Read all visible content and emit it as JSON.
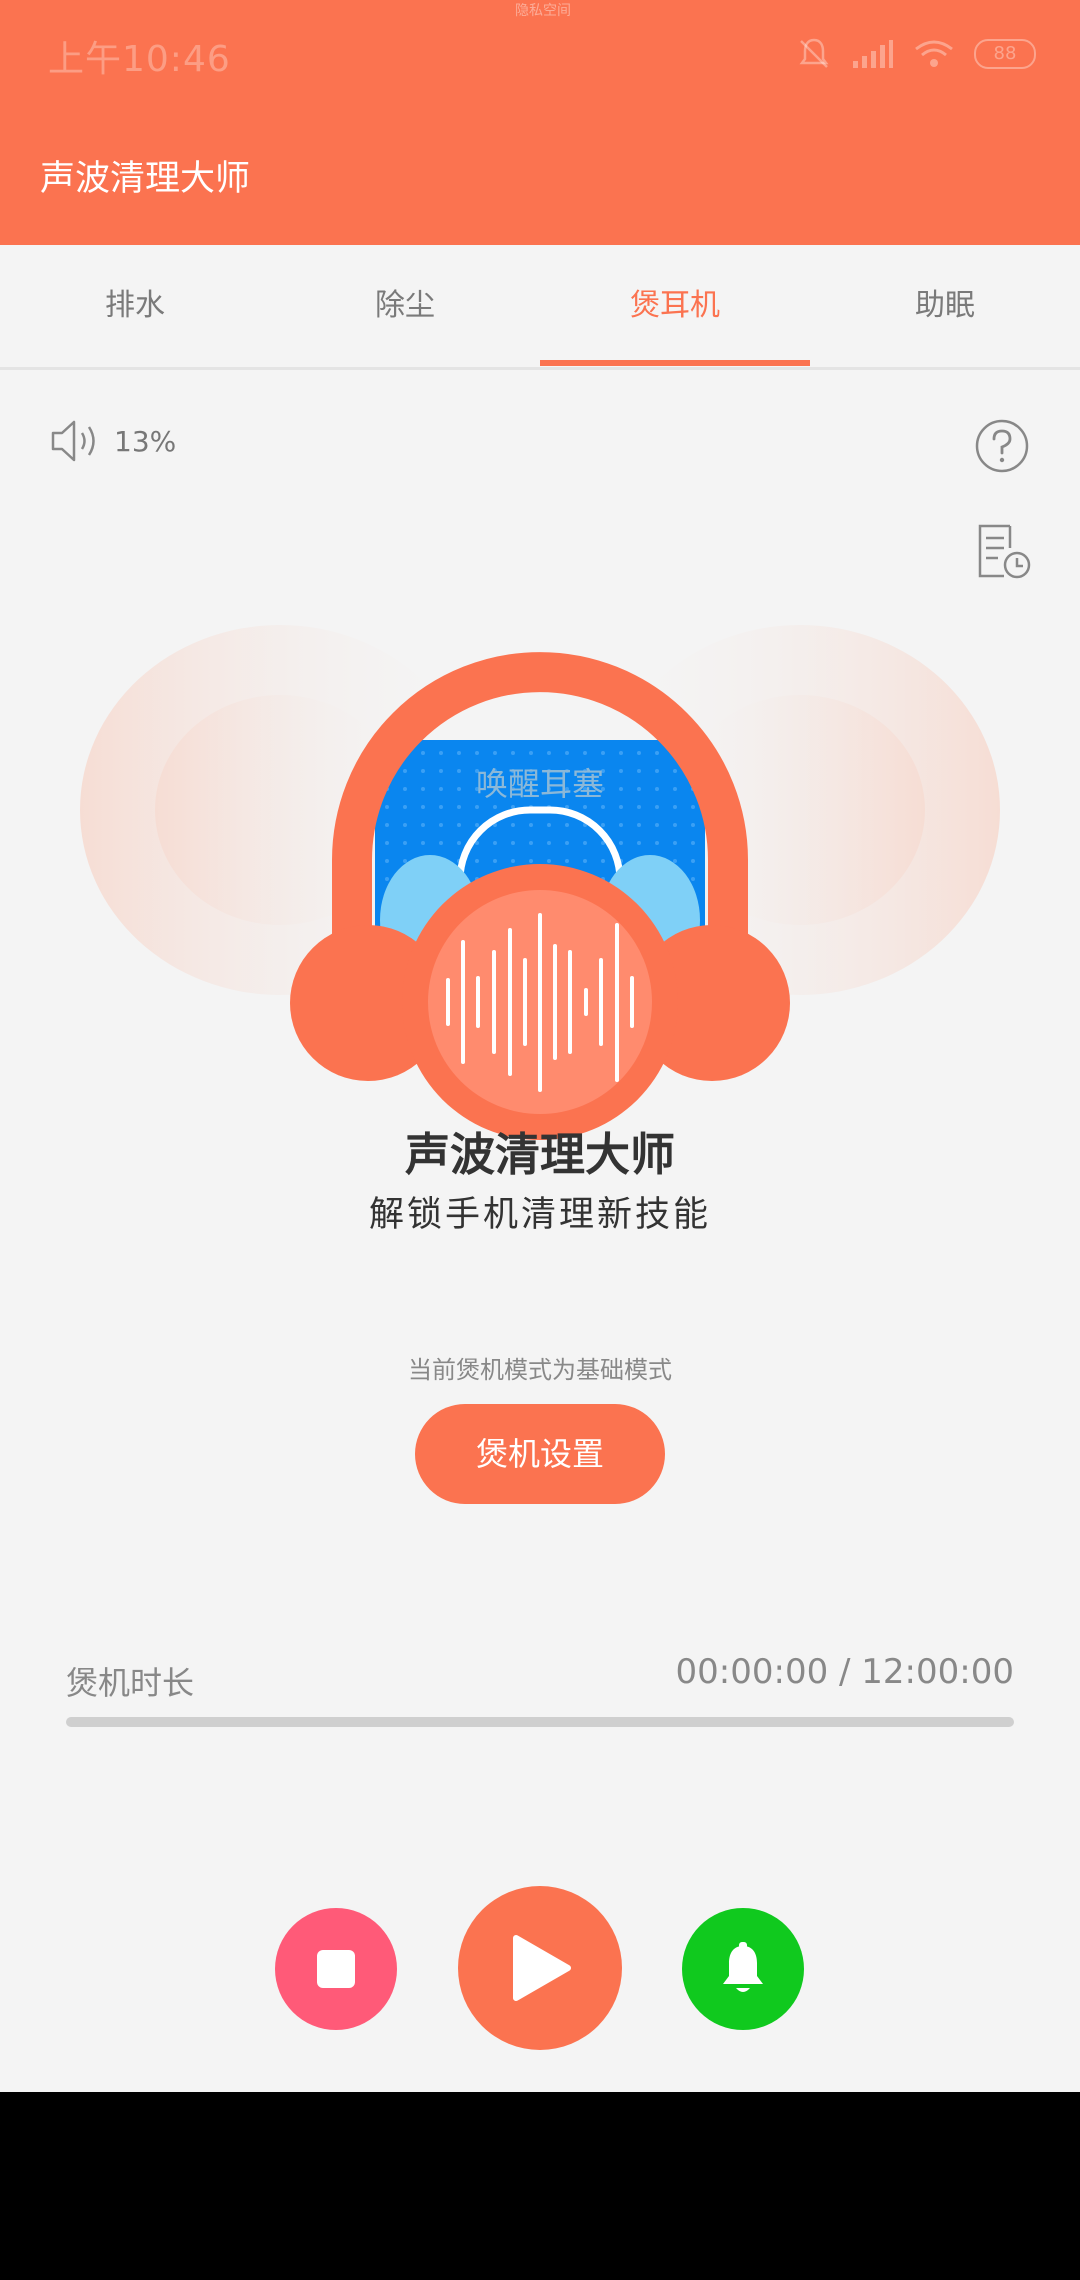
{
  "status_bar": {
    "time": "上午10:46",
    "battery": "88",
    "notch_label": "隐私空间"
  },
  "header": {
    "title": "声波清理大师"
  },
  "tabs": [
    {
      "label": "排水"
    },
    {
      "label": "除尘"
    },
    {
      "label": "煲耳机",
      "active": true
    },
    {
      "label": "助眠"
    }
  ],
  "volume": {
    "value_text": "13%"
  },
  "hero": {
    "overlay_text": "唤醒耳塞",
    "title": "声波清理大师",
    "subtitle": "解锁手机清理新技能"
  },
  "mode": {
    "text": "当前煲机模式为基础模式",
    "button_label": "煲机设置"
  },
  "duration": {
    "label": "煲机时长",
    "time": "00:00:00 / 12:00:00",
    "progress": 0
  },
  "controls": {
    "stop_color": "#ff5a78",
    "play_color": "#fb7350",
    "bell_color": "#10c91e"
  },
  "icons": [
    "speaker-icon",
    "help-icon",
    "history-icon",
    "headphones-illustration",
    "stop-icon",
    "play-icon",
    "bell-icon"
  ],
  "colors": {
    "accent": "#fb7350",
    "background": "#f4f4f4"
  }
}
